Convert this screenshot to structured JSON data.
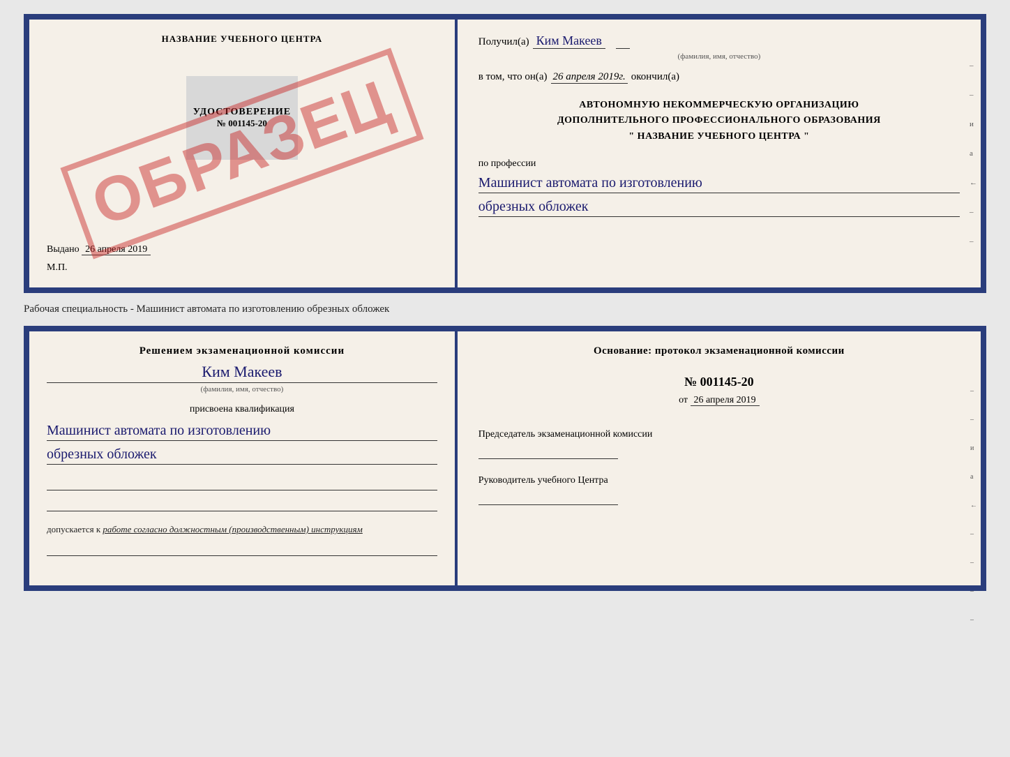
{
  "top_document": {
    "left": {
      "org_name": "НАЗВАНИЕ УЧЕБНОГО ЦЕНТРА",
      "stamp_text": "ОБРАЗЕЦ",
      "cert_title": "УДОСТОВЕРЕНИЕ",
      "cert_number": "№ 001145-20",
      "issued_label": "Выдано",
      "issued_date": "26 апреля 2019",
      "mp_label": "М.П."
    },
    "right": {
      "received_label": "Получил(а)",
      "recipient_name": "Ким Макеев",
      "fio_subtitle": "(фамилия, имя, отчество)",
      "in_that_label": "в том, что он(а)",
      "completion_date": "26 апреля 2019г.",
      "finished_label": "окончил(а)",
      "org_description_line1": "АВТОНОМНУЮ НЕКОММЕРЧЕСКУЮ ОРГАНИЗАЦИЮ",
      "org_description_line2": "ДОПОЛНИТЕЛЬНОГО ПРОФЕССИОНАЛЬНОГО ОБРАЗОВАНИЯ",
      "org_description_line3": "\" НАЗВАНИЕ УЧЕБНОГО ЦЕНТРА \"",
      "profession_label": "по профессии",
      "profession_line1": "Машинист автомата по изготовлению",
      "profession_line2": "обрезных обложек"
    }
  },
  "caption": {
    "text": "Рабочая специальность - Машинист автомата по изготовлению обрезных обложек"
  },
  "bottom_document": {
    "left": {
      "decision_label": "Решением экзаменационной комиссии",
      "person_name": "Ким Макеев",
      "fio_subtitle": "(фамилия, имя, отчество)",
      "qualification_label": "присвоена квалификация",
      "qualification_line1": "Машинист автомата по изготовлению",
      "qualification_line2": "обрезных обложек",
      "admitted_label": "допускается к",
      "admitted_text": "работе согласно должностным (производственным) инструкциям"
    },
    "right": {
      "basis_label": "Основание: протокол экзаменационной комиссии",
      "protocol_number": "№ 001145-20",
      "date_prefix": "от",
      "protocol_date": "26 апреля 2019",
      "chairman_label": "Председатель экзаменационной комиссии",
      "director_label": "Руководитель учебного Центра"
    }
  },
  "right_marks": {
    "items": [
      "–",
      "–",
      "–",
      "и",
      "а",
      "←",
      "–",
      "–",
      "–",
      "–"
    ]
  }
}
